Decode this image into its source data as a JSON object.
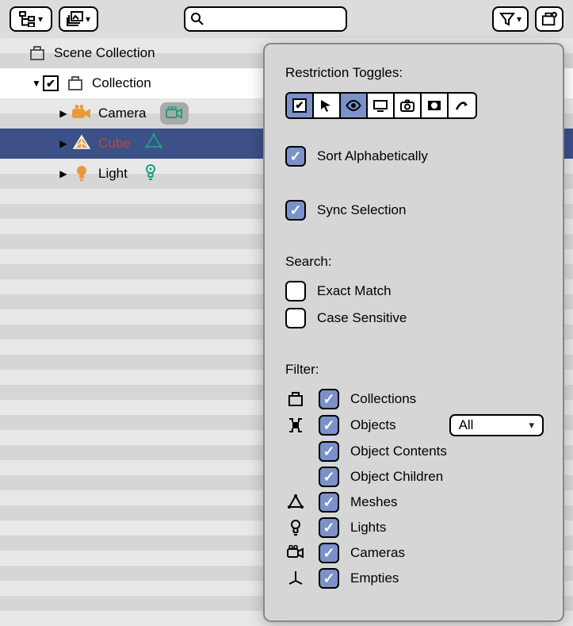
{
  "toolbar": {
    "search_placeholder": ""
  },
  "outliner": {
    "scene_collection": "Scene Collection",
    "collection": "Collection",
    "camera": "Camera",
    "cube": "Cube",
    "light": "Light"
  },
  "popover": {
    "restriction_toggles_title": "Restriction Toggles:",
    "sort_alpha": "Sort Alphabetically",
    "sync_selection": "Sync Selection",
    "search_title": "Search:",
    "exact_match": "Exact Match",
    "case_sensitive": "Case Sensitive",
    "filter_title": "Filter:",
    "collections": "Collections",
    "objects": "Objects",
    "objects_mode": "All",
    "object_contents": "Object Contents",
    "object_children": "Object Children",
    "meshes": "Meshes",
    "lights": "Lights",
    "cameras": "Cameras",
    "empties": "Empties"
  }
}
